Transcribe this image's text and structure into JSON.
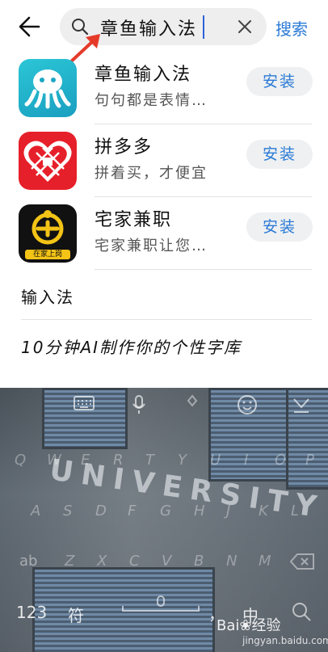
{
  "search": {
    "value": "章鱼输入法",
    "action_label": "搜索"
  },
  "results": [
    {
      "name": "章鱼输入法",
      "desc": "句句都是表情…",
      "button": "安装",
      "icon": "octopus-app-icon",
      "color": "#1fb3c9"
    },
    {
      "name": "拼多多",
      "desc": "拼着买，才便宜",
      "button": "安装",
      "icon": "pinduoduo-app-icon",
      "color": "#e6202a"
    },
    {
      "name": "宅家兼职",
      "desc": "宅家兼职让您…",
      "button": "安装",
      "icon": "zhaijia-app-icon",
      "color": "#111111"
    }
  ],
  "zhaijia_icon_caption": "在家上岗",
  "suggestions": [
    "输入法",
    "10分钟AI制作你的个性字库"
  ],
  "keyboard": {
    "row1": [
      "Q",
      "W",
      "E",
      "R",
      "T",
      "Y",
      "U",
      "I",
      "O",
      "P"
    ],
    "row2": [
      "A",
      "S",
      "D",
      "F",
      "G",
      "H",
      "J",
      "K",
      "L"
    ],
    "row3": [
      "Z",
      "X",
      "C",
      "V",
      "B",
      "N",
      "M"
    ],
    "shift_label": "ab",
    "num_label": "123",
    "symbol_label": "符",
    "comma_label": "，",
    "lang_label": "中",
    "sign_text": "UNIVERSITY"
  },
  "watermark": {
    "brand": "Bai",
    "suffix": "经验",
    "url": "jingyan.baidu.com"
  },
  "colors": {
    "accent": "#2a7ad6",
    "annotation_arrow": "#e53a2a"
  }
}
